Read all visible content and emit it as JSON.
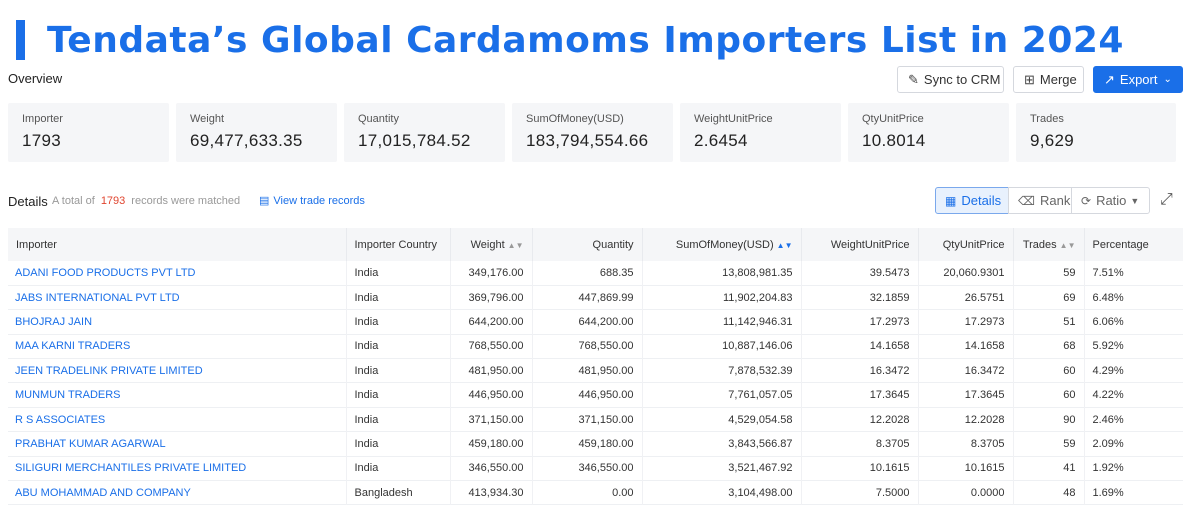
{
  "banner": {
    "title": "Tendata’s Global Cardamoms Importers List in 2024"
  },
  "overview": {
    "label": "Overview"
  },
  "actions": {
    "sync": "Sync to CRM",
    "merge": "Merge",
    "export": "Export"
  },
  "cards": [
    {
      "label": "Importer",
      "value": "1793"
    },
    {
      "label": "Weight",
      "value": "69,477,633.35"
    },
    {
      "label": "Quantity",
      "value": "17,015,784.52"
    },
    {
      "label": "SumOfMoney(USD)",
      "value": "183,794,554.66"
    },
    {
      "label": "WeightUnitPrice",
      "value": "2.6454"
    },
    {
      "label": "QtyUnitPrice",
      "value": "10.8014"
    },
    {
      "label": "Trades",
      "value": "9,629"
    }
  ],
  "details": {
    "title": "Details",
    "prefix": "A total of",
    "count": "1793",
    "suffix": "records were matched",
    "view_link": "View trade records",
    "views": {
      "details": "Details",
      "rank": "Rank",
      "ratio": "Ratio"
    }
  },
  "table": {
    "headers": [
      "Importer",
      "Importer Country",
      "Weight",
      "Quantity",
      "SumOfMoney(USD)",
      "WeightUnitPrice",
      "QtyUnitPrice",
      "Trades",
      "Percentage"
    ],
    "rows": [
      [
        "ADANI FOOD PRODUCTS PVT LTD",
        "India",
        "349,176.00",
        "688.35",
        "13,808,981.35",
        "39.5473",
        "20,060.9301",
        "59",
        "7.51%"
      ],
      [
        "JABS INTERNATIONAL PVT LTD",
        "India",
        "369,796.00",
        "447,869.99",
        "11,902,204.83",
        "32.1859",
        "26.5751",
        "69",
        "6.48%"
      ],
      [
        "BHOJRAJ JAIN",
        "India",
        "644,200.00",
        "644,200.00",
        "11,142,946.31",
        "17.2973",
        "17.2973",
        "51",
        "6.06%"
      ],
      [
        "MAA KARNI TRADERS",
        "India",
        "768,550.00",
        "768,550.00",
        "10,887,146.06",
        "14.1658",
        "14.1658",
        "68",
        "5.92%"
      ],
      [
        "JEEN TRADELINK PRIVATE LIMITED",
        "India",
        "481,950.00",
        "481,950.00",
        "7,878,532.39",
        "16.3472",
        "16.3472",
        "60",
        "4.29%"
      ],
      [
        "MUNMUN TRADERS",
        "India",
        "446,950.00",
        "446,950.00",
        "7,761,057.05",
        "17.3645",
        "17.3645",
        "60",
        "4.22%"
      ],
      [
        "R S ASSOCIATES",
        "India",
        "371,150.00",
        "371,150.00",
        "4,529,054.58",
        "12.2028",
        "12.2028",
        "90",
        "2.46%"
      ],
      [
        "PRABHAT KUMAR AGARWAL",
        "India",
        "459,180.00",
        "459,180.00",
        "3,843,566.87",
        "8.3705",
        "8.3705",
        "59",
        "2.09%"
      ],
      [
        "SILIGURI MERCHANTILES PRIVATE LIMITED",
        "India",
        "346,550.00",
        "346,550.00",
        "3,521,467.92",
        "10.1615",
        "10.1615",
        "41",
        "1.92%"
      ],
      [
        "ABU MOHAMMAD AND COMPANY",
        "Bangladesh",
        "413,934.30",
        "0.00",
        "3,104,498.00",
        "7.5000",
        "0.0000",
        "48",
        "1.69%"
      ]
    ]
  }
}
